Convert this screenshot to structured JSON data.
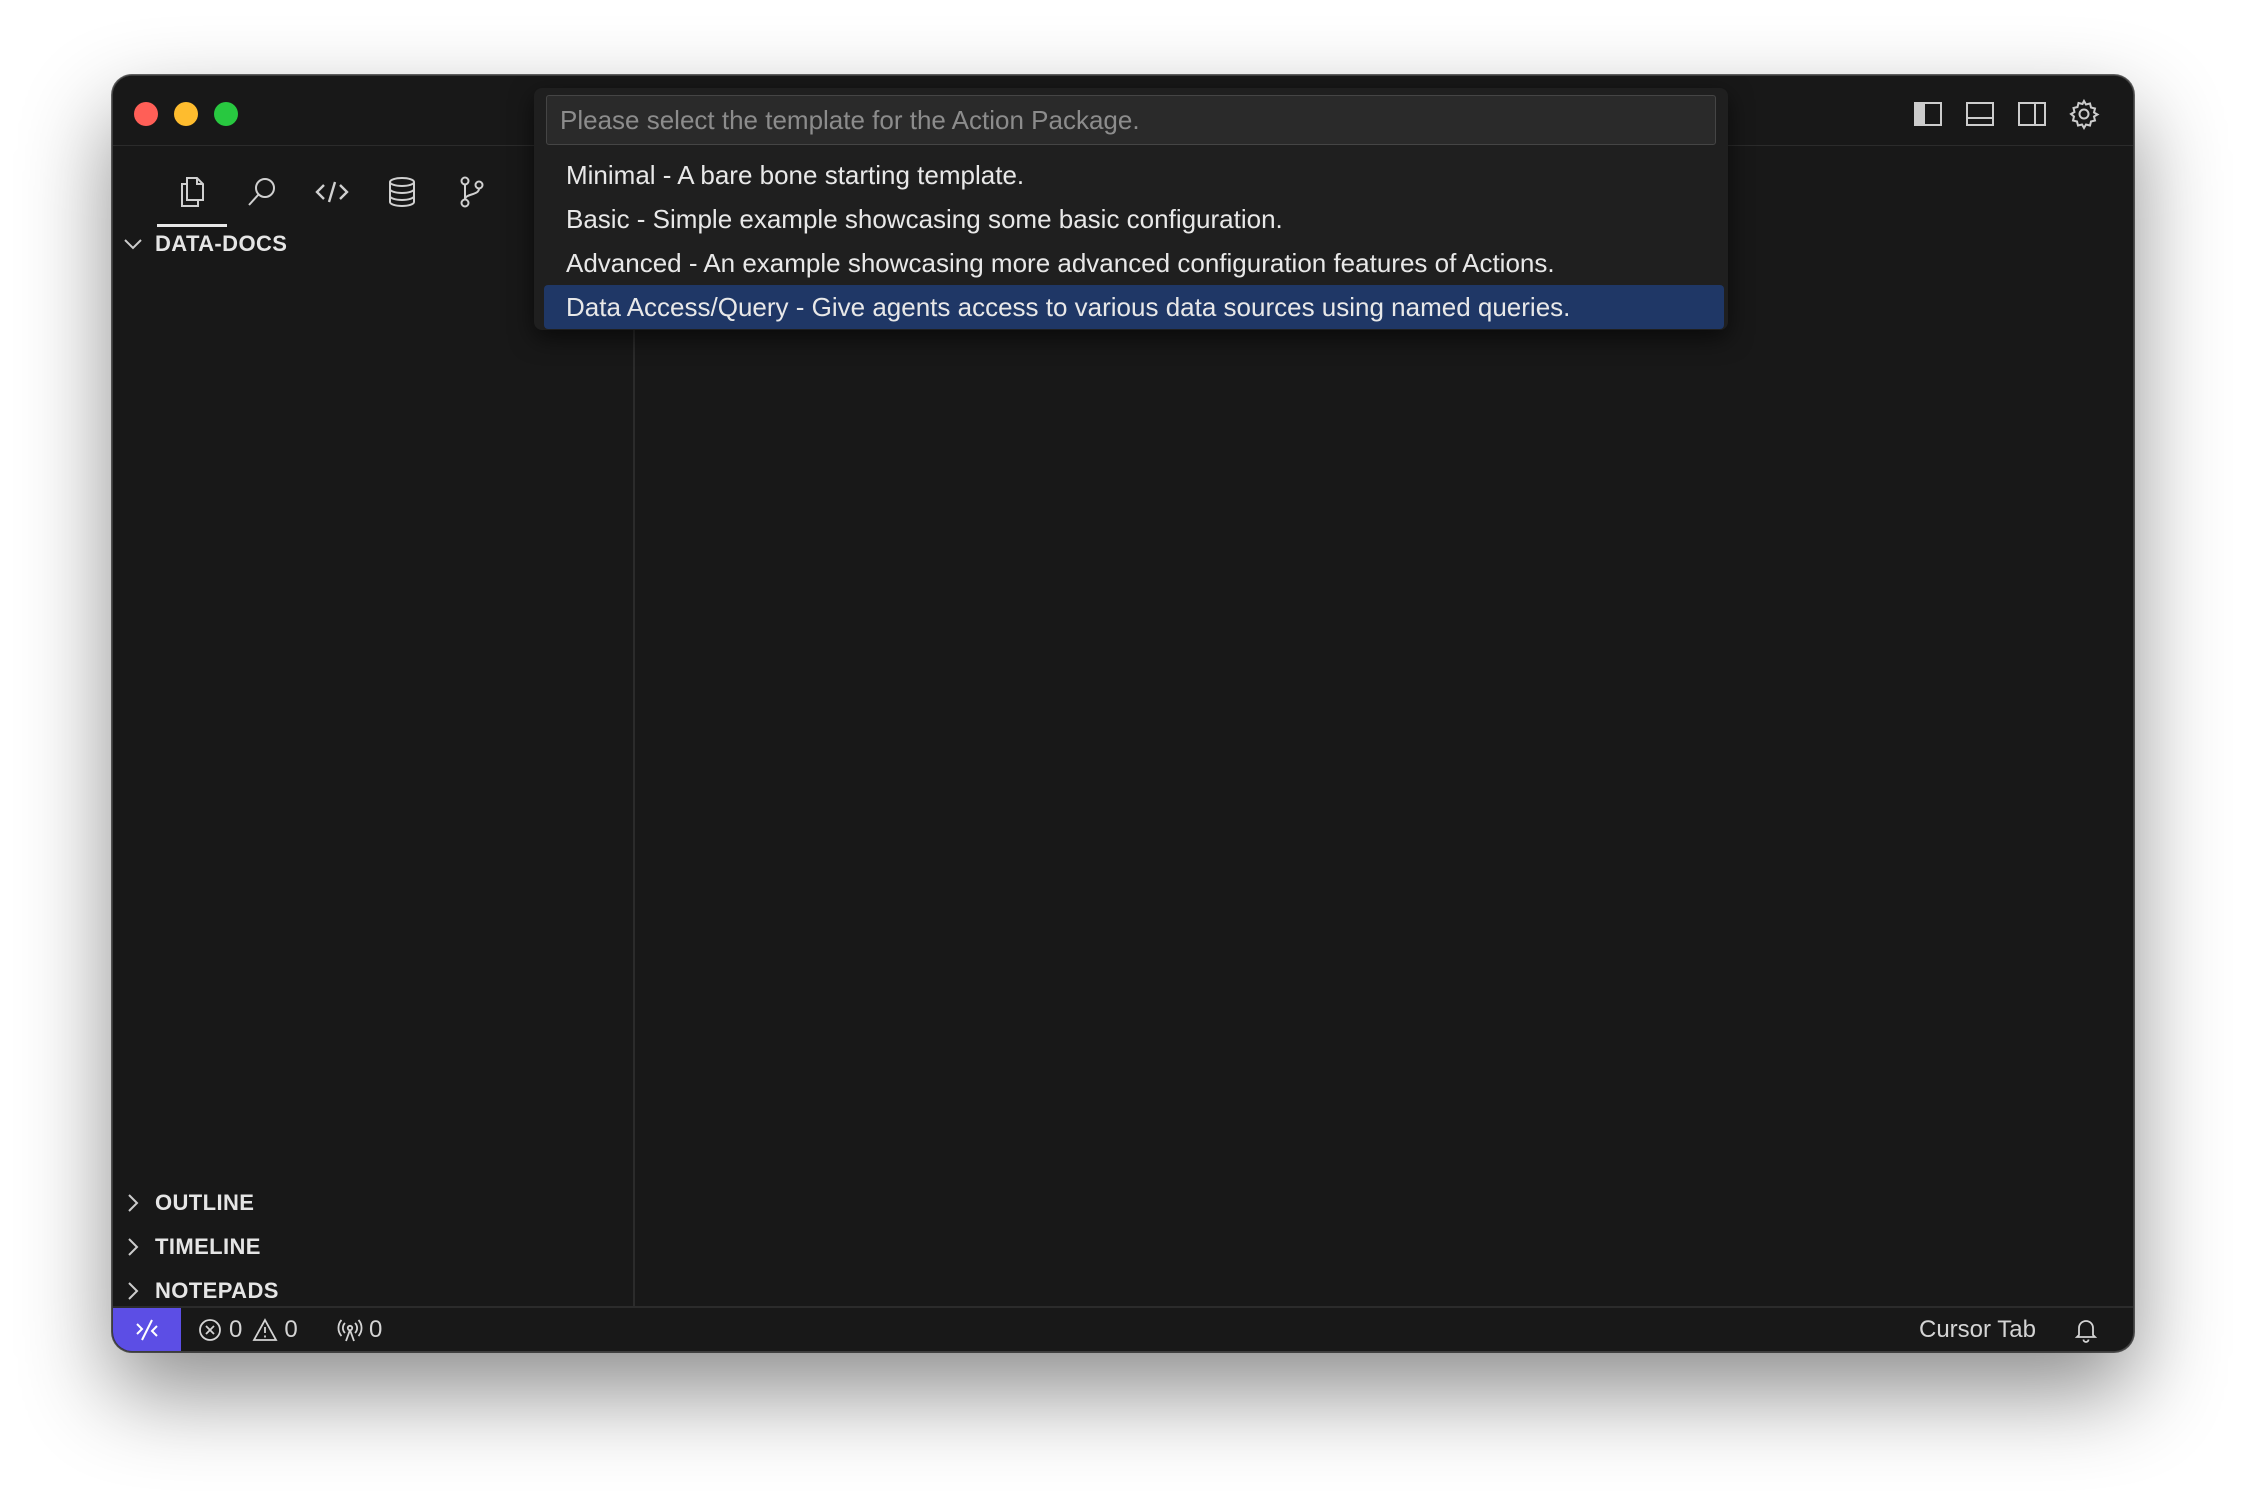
{
  "window": {
    "controls": [
      "close",
      "minimize",
      "maximize"
    ]
  },
  "layout_controls": [
    "toggle-primary-sidebar-icon",
    "toggle-panel-icon",
    "toggle-secondary-sidebar-icon",
    "gear-icon"
  ],
  "activity_bar": [
    "files-icon",
    "search-icon",
    "code-icon",
    "database-icon",
    "source-control-icon"
  ],
  "sidebar": {
    "explorer_title": "DATA-DOCS",
    "sections": [
      {
        "label": "OUTLINE"
      },
      {
        "label": "TIMELINE"
      },
      {
        "label": "NOTEPADS"
      }
    ]
  },
  "quick_pick": {
    "placeholder": "Please select the template for the Action Package.",
    "value": "",
    "items": [
      {
        "label": "Minimal - A bare bone starting template.",
        "selected": false
      },
      {
        "label": "Basic - Simple example showcasing some basic configuration.",
        "selected": false
      },
      {
        "label": "Advanced - An example showcasing more advanced configuration features of Actions.",
        "selected": false
      },
      {
        "label": "Data Access/Query - Give agents access to various data sources using named queries.",
        "selected": true
      }
    ]
  },
  "statusbar": {
    "errors": "0",
    "warnings": "0",
    "ports": "0",
    "cursor_tab": "Cursor Tab"
  },
  "colors": {
    "remote_accent": "#5c4ee5",
    "selection": "#1f3766",
    "background": "#181818"
  }
}
